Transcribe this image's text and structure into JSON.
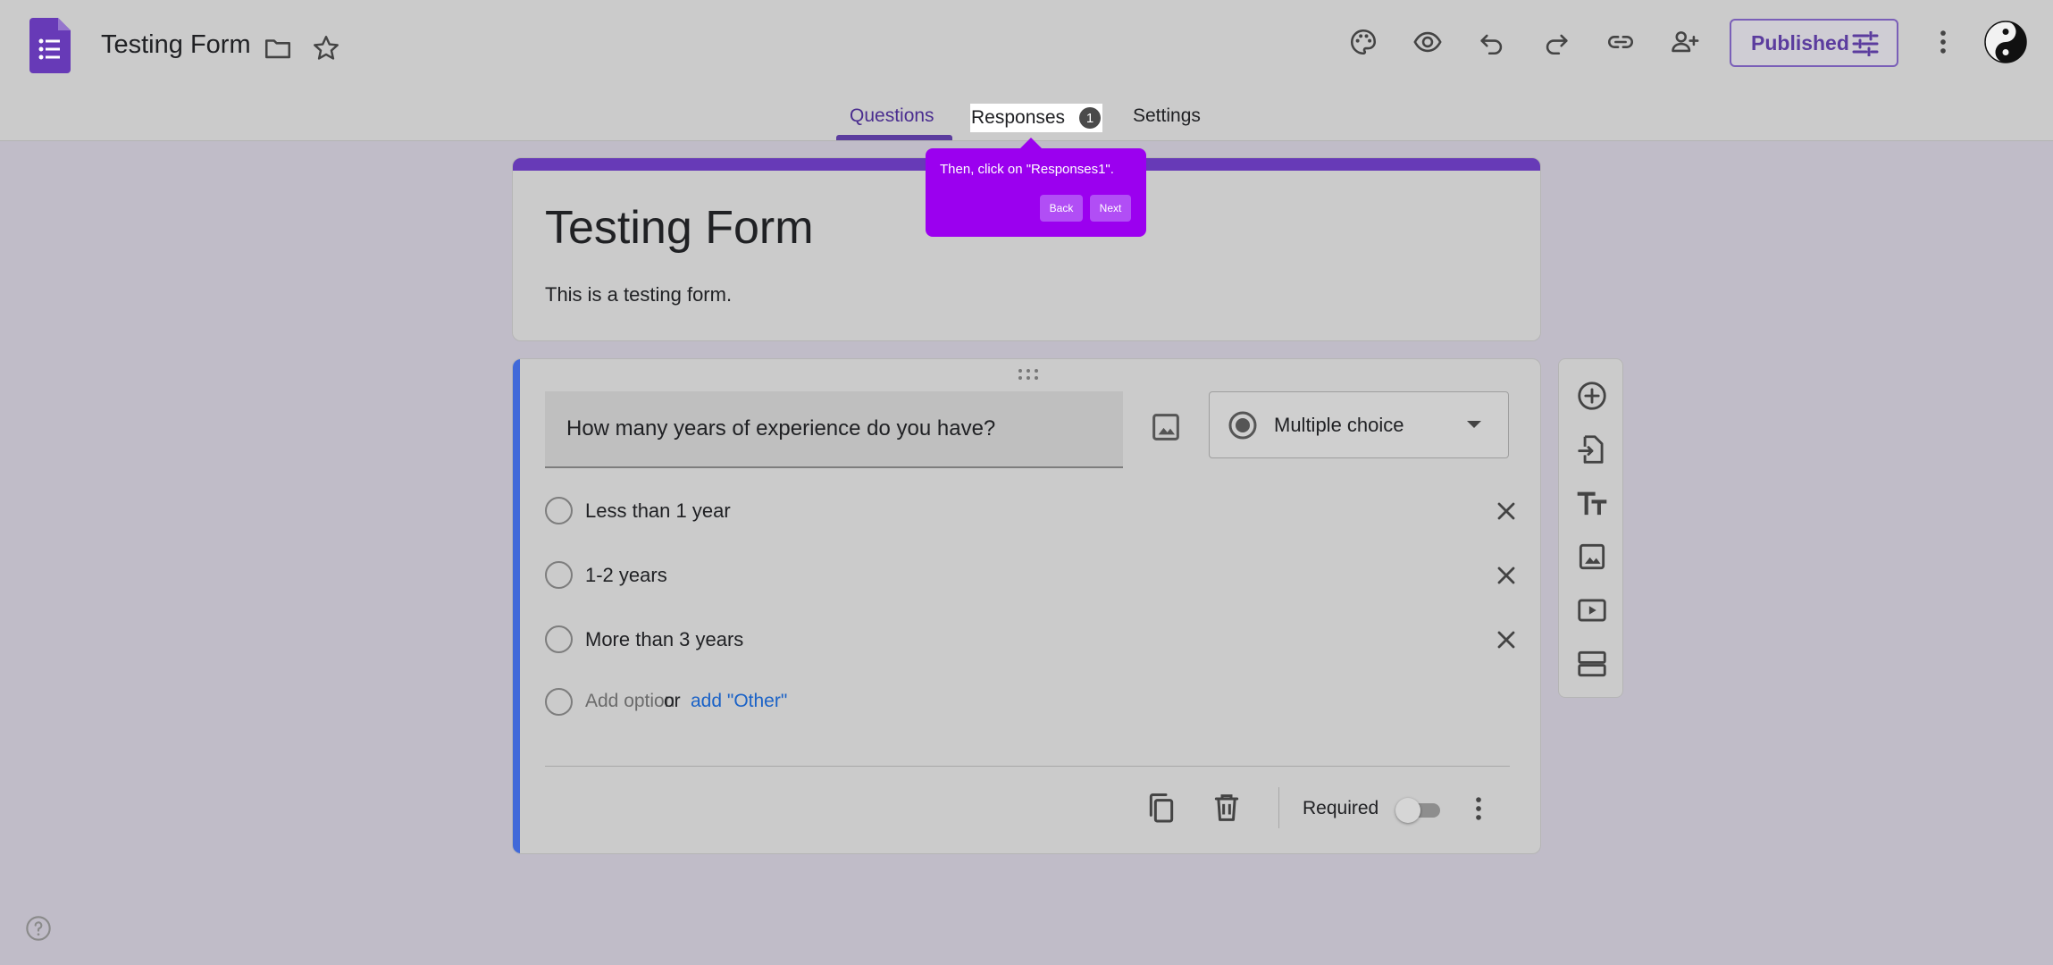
{
  "header": {
    "doc_title": "Testing Form",
    "publish_label": "Published",
    "icons": [
      "forms-logo-icon",
      "folder-icon",
      "star-icon",
      "palette-icon",
      "preview-eye-icon",
      "undo-icon",
      "redo-icon",
      "link-icon",
      "add-collaborator-icon",
      "tune-icon",
      "more-vert-icon",
      "avatar-yin-yang"
    ]
  },
  "tabs": {
    "questions": "Questions",
    "responses": "Responses",
    "responses_count": "1",
    "settings": "Settings"
  },
  "tooltip": {
    "text": "Then, click on \"Responses1\".",
    "back": "Back",
    "next": "Next"
  },
  "form": {
    "title": "Testing Form",
    "description": "This is a testing form."
  },
  "question": {
    "text": "How many years of experience do you have?",
    "type": "Multiple choice",
    "options": [
      "Less than 1 year",
      "1-2 years",
      "More than 3 years"
    ],
    "add_option": "Add option",
    "or": "or",
    "add_other": "add \"Other\"",
    "required_label": "Required",
    "required": false
  },
  "colors": {
    "accent": "#673ab7",
    "tooltip": "#9b00ef",
    "question_bar": "#4169d9",
    "link": "#1a62c7"
  }
}
